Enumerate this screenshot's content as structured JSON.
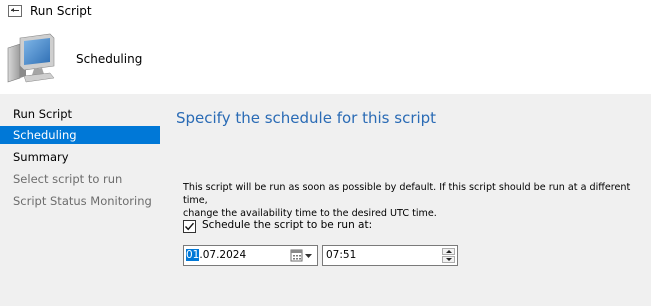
{
  "window": {
    "title": "Run Script",
    "app_icon": "script-window-icon"
  },
  "header": {
    "icon": "computer-icon",
    "title": "Scheduling"
  },
  "sidebar": {
    "items": [
      {
        "label": "Run Script",
        "state": "normal"
      },
      {
        "label": "Scheduling",
        "state": "active"
      },
      {
        "label": "Summary",
        "state": "normal"
      },
      {
        "label": "Select script to run",
        "state": "disabled"
      },
      {
        "label": "Script Status Monitoring",
        "state": "disabled"
      }
    ]
  },
  "main": {
    "heading": "Specify the schedule for this script",
    "description_line1": "This script will be run as soon as possible by default. If this script should be run at a different time,",
    "description_line2": "change the availability time to the desired UTC time.",
    "schedule_checkbox": {
      "label": "Schedule the script to be run at:",
      "checked": true
    },
    "date": {
      "selected_part": "01",
      "rest": ".07.2024"
    },
    "time": {
      "value": "07:51"
    }
  },
  "colors": {
    "accent": "#0078d7",
    "heading": "#2a6bb5",
    "panel_bg": "#f0f0f0"
  }
}
